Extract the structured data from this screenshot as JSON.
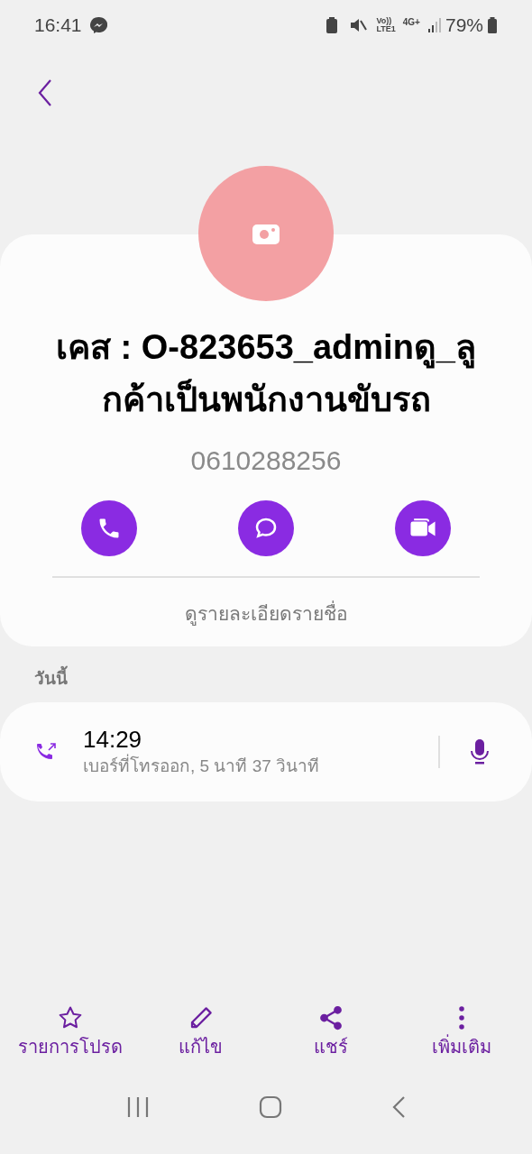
{
  "status_bar": {
    "time": "16:41",
    "volte_top": "Vo))",
    "volte_bottom": "LTE1",
    "network": "4G+",
    "battery": "79%"
  },
  "contact": {
    "name": "เคส : O-823653_adminดู_ลูกค้าเป็นพนักงานขับรถ",
    "phone": "0610288256",
    "actions": [
      {
        "kind": "call"
      },
      {
        "kind": "message"
      },
      {
        "kind": "video"
      }
    ],
    "details_link": "ดูรายละเอียดรายชื่อ"
  },
  "history": {
    "section": "วันนี้",
    "calls": [
      {
        "time": "14:29",
        "detail": "เบอร์ที่โทรออก, 5 นาที 37 วินาที"
      }
    ]
  },
  "bottom_actions": [
    {
      "kind": "favorite",
      "label": "รายการโปรด"
    },
    {
      "kind": "edit",
      "label": "แก้ไข"
    },
    {
      "kind": "share",
      "label": "แชร์"
    },
    {
      "kind": "more",
      "label": "เพิ่มเติม"
    }
  ]
}
